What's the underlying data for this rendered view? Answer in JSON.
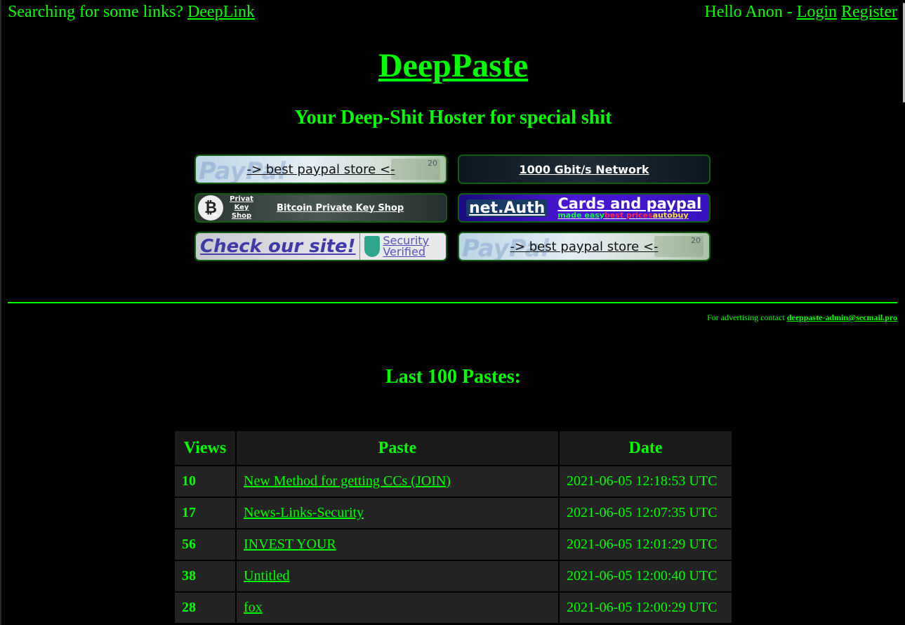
{
  "topbar": {
    "prompt": "Searching for some links?",
    "deeplink": "DeepLink",
    "greeting": "Hello Anon -",
    "login": "Login",
    "register": "Register"
  },
  "site": {
    "title": "DeepPaste",
    "tagline": "Your Deep-Shit Hoster for special shit"
  },
  "ads": {
    "paypal_1": "-> best paypal store <-",
    "paypal_watermark": "PayPal",
    "paypal_note": "20",
    "network": "1000 Gbit/s Network",
    "bitcoin_small": "Privat Key Shop",
    "bitcoin_main": "Bitcoin Private Key Shop",
    "netauth_logo": "net.Auth",
    "netauth_headline": "Cards and paypal",
    "netauth_made_easy": "made easy",
    "netauth_best_prices": "best prices",
    "netauth_autobuy": "autobuy",
    "check_site": "Check our site!",
    "security_verified_1": "Security",
    "security_verified_2": "Verified",
    "paypal_2": "-> best paypal store <-"
  },
  "advertising": {
    "text": "For advertising contact",
    "email": "deeppaste-admin@secmail.pro"
  },
  "list": {
    "title": "Last 100 Pastes:",
    "columns": [
      "Views",
      "Paste",
      "Date"
    ],
    "rows": [
      {
        "views": "10",
        "paste": "New Method for getting CCs (JOIN)",
        "date": "2021-06-05 12:18:53 UTC"
      },
      {
        "views": "17",
        "paste": "News-Links-Security",
        "date": "2021-06-05 12:07:35 UTC"
      },
      {
        "views": "56",
        "paste": "INVEST YOUR",
        "date": "2021-06-05 12:01:29 UTC"
      },
      {
        "views": "38",
        "paste": "Untitled",
        "date": "2021-06-05 12:00:40 UTC"
      },
      {
        "views": "28",
        "paste": "fox",
        "date": "2021-06-05 12:00:29 UTC"
      }
    ]
  }
}
